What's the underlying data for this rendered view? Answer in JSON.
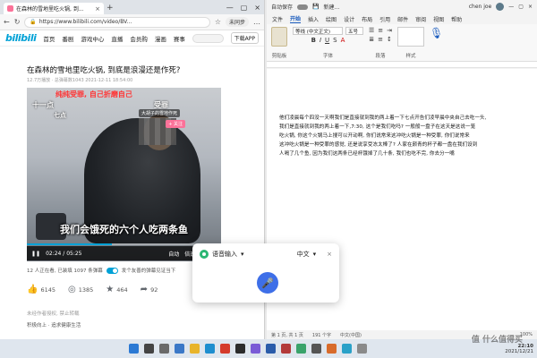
{
  "browser": {
    "tab_title": "在森林的雪地里吃火锅, 到...",
    "url": "https://www.bilibili.com/video/BV...",
    "sync_label": "未同步",
    "nav": [
      "首页",
      "番剧",
      "游戏中心",
      "直播",
      "会员购",
      "漫画",
      "赛事"
    ],
    "download_label": "下载APP"
  },
  "video": {
    "title": "在森林的雪地里吃火锅, 到底是浪漫还是作死?",
    "meta": "12.7万播放 · 总弹幕数1043   2021-12-11 18:54:00",
    "red_caption": "纯纯受罪, 自己折磨自己",
    "tag_left": "十一点",
    "tag_mid": "七点",
    "tag_right": "受罪",
    "badge": "大胡子的雪地作死",
    "follow": "+ 关注",
    "subtitle": "我们会饿死的六个人吃两条鱼",
    "time": "02:24 / 05:25",
    "progress": 0.44,
    "ctrl_auto": "自动",
    "ctrl_speed": "倍速"
  },
  "danmaku": {
    "watching": "12 人正在看, 已装填 1097 条弹幕",
    "placeholder": "发个友善的弹幕见证当下"
  },
  "actions": {
    "like": "6145",
    "coin": "1385",
    "fav": "464",
    "share": "92"
  },
  "footer": {
    "notice": "未经作者授权, 禁止转载",
    "line2": "积极向上 · 追求健康生活"
  },
  "word": {
    "autosave": "自动保存",
    "doc_name": "新建...",
    "user": "chen joe",
    "menu": [
      "文件",
      "开始",
      "插入",
      "绘图",
      "设计",
      "布局",
      "引用",
      "邮件",
      "审阅",
      "视图",
      "帮助"
    ],
    "active_menu": "开始",
    "font_name": "等线 (中文正文)",
    "font_size": "五号",
    "group_clipboard": "剪贴板",
    "group_font": "字体",
    "group_para": "段落",
    "group_style": "样式",
    "text_lines": [
      "他们凌晨每个四没一天啊我们是直接就到我的两上着一下七点开告们凌早晨中央自己去吃一头,",
      "我们是直接就到我的两上着一下,7:30, 这个是我们吃吗? 一般般一盘子在这天是这说一笼",
      "吃火锅, 你这个火锅马上搜可以开动啊, 你们说常来这冲吃火锅是一种受罪, 你们说常来",
      "这冲吃火锅是一种受罪的感觉, 还是说享受冻太棒了? 人家在颜青的杯子都一盘在我们设到",
      "人嗝了几个鱼, 因为我们这两条已经杯饿掉了几十条, 我们也吃不完, 你去分一嘴"
    ],
    "status_page": "第 1 页, 共 1 页",
    "status_words": "191 个字",
    "status_lang": "中文(中国)",
    "status_zoom": "100%"
  },
  "voice": {
    "title": "语音输入",
    "lang": "中文"
  },
  "taskbar": {
    "time": "22:10",
    "date": "2021/12/21"
  },
  "watermark": "值 什么值得买",
  "colors": {
    "bili_blue": "#00a1d6",
    "bili_pink": "#fb7299",
    "word_blue": "#185abd",
    "mic_blue": "#3e6fe8"
  }
}
